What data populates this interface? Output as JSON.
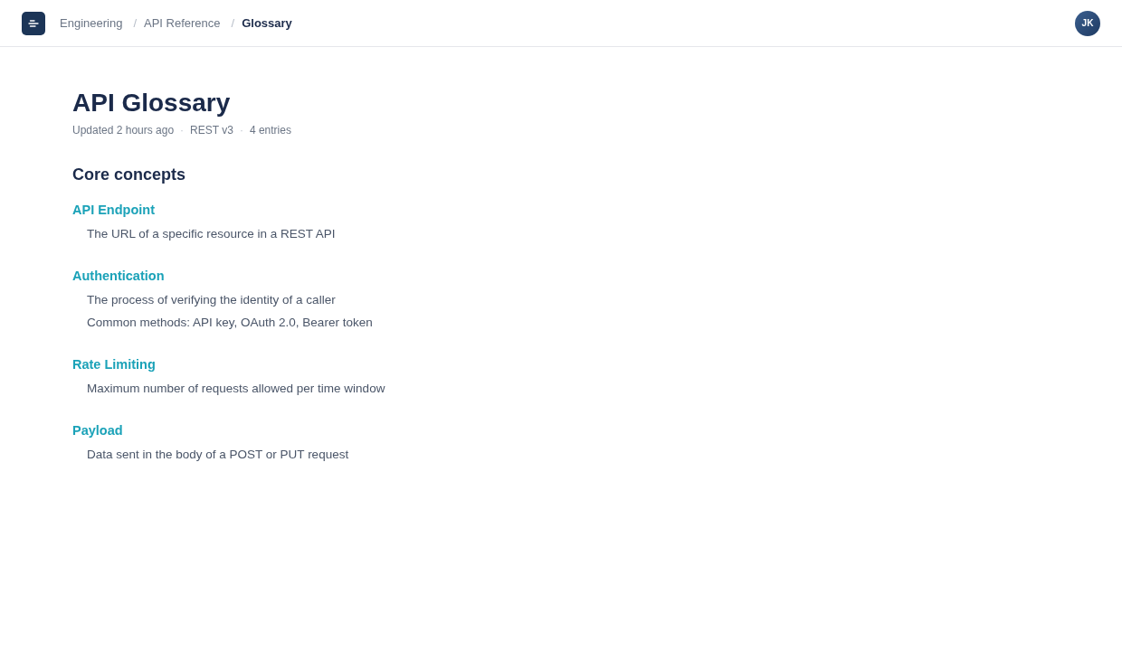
{
  "header": {
    "breadcrumb": {
      "separator": "/",
      "items": [
        {
          "label": "Engineering",
          "current": false
        },
        {
          "label": "API Reference",
          "current": false
        },
        {
          "label": "Glossary",
          "current": true
        }
      ]
    },
    "avatar": {
      "initials": "JK"
    }
  },
  "page": {
    "title": "API Glossary",
    "meta": {
      "separator": "·",
      "items": [
        "Updated 2 hours ago",
        "REST v3",
        "4 entries"
      ]
    },
    "sections": [
      {
        "heading": "Core concepts",
        "terms": [
          {
            "term": "API Endpoint",
            "definitions": [
              "The URL of a specific resource in a REST API"
            ]
          },
          {
            "term": "Authentication",
            "definitions": [
              "The process of verifying the identity of a caller",
              "Common methods: API key, OAuth 2.0, Bearer token"
            ]
          },
          {
            "term": "Rate Limiting",
            "definitions": [
              "Maximum number of requests allowed per time window"
            ]
          },
          {
            "term": "Payload",
            "definitions": [
              "Data sent in the body of a POST or PUT request"
            ]
          }
        ]
      }
    ]
  }
}
